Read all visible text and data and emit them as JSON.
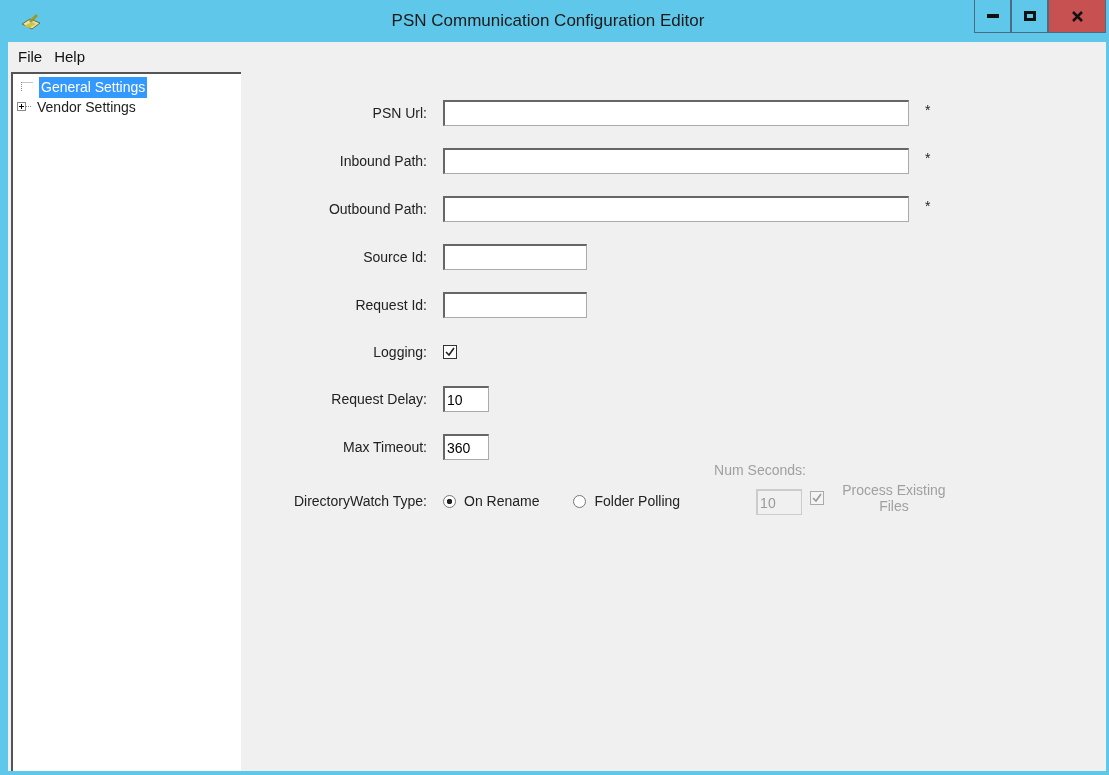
{
  "window": {
    "title": "PSN Communication Configuration Editor"
  },
  "menu": [
    "File",
    "Help"
  ],
  "tree": [
    {
      "label": "General Settings",
      "selected": true,
      "has_children": false
    },
    {
      "label": "Vendor Settings",
      "selected": false,
      "has_children": true,
      "expanded": false
    }
  ],
  "fields": [
    {
      "kind": "long",
      "label": "PSN Url:",
      "required_mark": "*"
    },
    {
      "kind": "long",
      "label": "Inbound Path:",
      "required_mark": "*"
    },
    {
      "kind": "long",
      "label": "Outbound Path:",
      "required_mark": "*"
    },
    {
      "kind": "medium",
      "label": "Source Id:"
    },
    {
      "kind": "medium",
      "label": "Request Id:"
    },
    {
      "kind": "checkbox",
      "label": "Logging:",
      "checked": true
    },
    {
      "kind": "small",
      "label": "Request Delay:",
      "value": "10"
    },
    {
      "kind": "small",
      "label": "Max Timeout:",
      "value": "360"
    }
  ],
  "directory_watch": {
    "label": "DirectoryWatch Type:",
    "options": [
      {
        "label": "On Rename",
        "selected": true
      },
      {
        "label": "Folder Polling",
        "selected": false
      }
    ],
    "num_seconds": {
      "label": "Num Seconds:",
      "value": "10",
      "disabled": true
    },
    "process_existing": {
      "label": "Process Existing Files",
      "checked": true,
      "disabled": true
    }
  }
}
